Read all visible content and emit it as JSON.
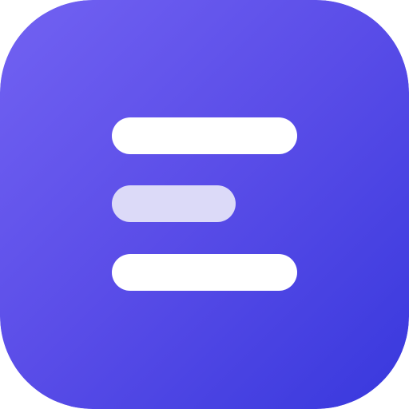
{
  "app_icon": {
    "name": "menu-lines-app-icon",
    "icon_glyph": "three-horizontal-lines-icon",
    "colors": {
      "gradient_start": "#7262F2",
      "gradient_mid": "#5A4DE8",
      "gradient_end": "#3838DD",
      "line_primary": "#FFFFFF",
      "line_secondary": "#DCDAF8"
    }
  }
}
